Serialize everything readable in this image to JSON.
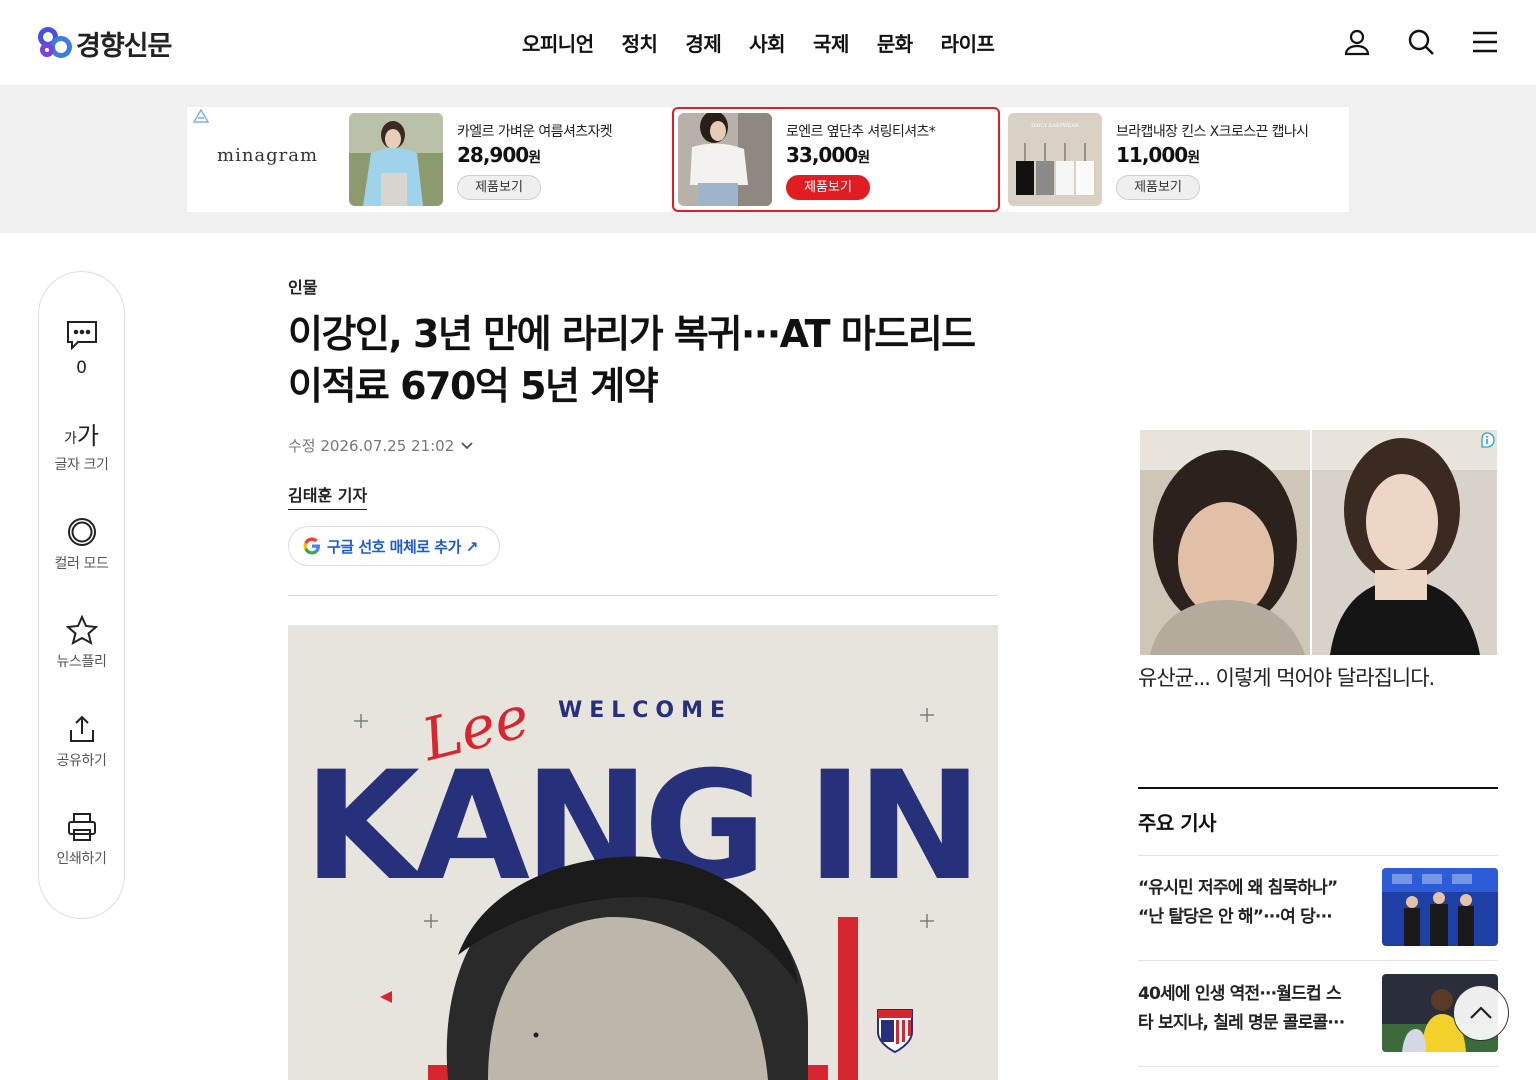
{
  "header": {
    "logo_text": "경향신문",
    "nav": [
      "오피니언",
      "정치",
      "경제",
      "사회",
      "국제",
      "문화",
      "라이프"
    ],
    "icons": [
      "user-icon",
      "search-icon",
      "menu-icon"
    ]
  },
  "ad_banner": {
    "brand": "minagram",
    "items": [
      {
        "title": "카엘르 가벼운 여름셔츠자켓",
        "price": "28,900",
        "unit": "원",
        "button": "제품보기",
        "highlighted": false
      },
      {
        "title": "로엔르 옆단추 셔링티셔츠*",
        "price": "33,000",
        "unit": "원",
        "button": "제품보기",
        "highlighted": true
      },
      {
        "title": "브라캡내장 킨스 X크로스끈 캡나시",
        "price": "11,000",
        "unit": "원",
        "button": "제품보기",
        "highlighted": false
      }
    ],
    "third_label": "DAILY EASYWEAR",
    "accent": "#e11d24"
  },
  "toolbar": {
    "comments_count": "0",
    "font_glyph_small": "가",
    "font_glyph_big": "가",
    "items": [
      "글자 크기",
      "컬러 모드",
      "뉴스플리",
      "공유하기",
      "인쇄하기"
    ]
  },
  "article": {
    "category": "인물",
    "headline_line1": "이강인, 3년 만에 라리가 복귀···AT 마드리드",
    "headline_line2": "이적료 670억 5년 계약",
    "date": "수정 2026.07.25 21:02",
    "byline": "김태훈 기자",
    "google_button": "구글 선호 매체로 추가 ↗",
    "photo_text_small": "WELCOME",
    "photo_text_script": "Lee",
    "photo_text_big": "KANG IN"
  },
  "right": {
    "ad_caption": "유산균... 이렇게 먹어야 달라집니다.",
    "section_title": "주요 기사",
    "news": [
      {
        "line1": "“유시민 저주에 왜 침묵하나”",
        "line2": "“난 탈당은 안 해”···여 당···"
      },
      {
        "line1": "40세에 인생 역전···월드컵 스",
        "line2": "타 보지냐, 칠레 명문 콜로콜···"
      }
    ]
  },
  "colors": {
    "brand_blue": "#4b4fe0",
    "google_blue": "#1a5ad8",
    "atletico_navy": "#27307a",
    "atletico_red": "#d7262f"
  }
}
